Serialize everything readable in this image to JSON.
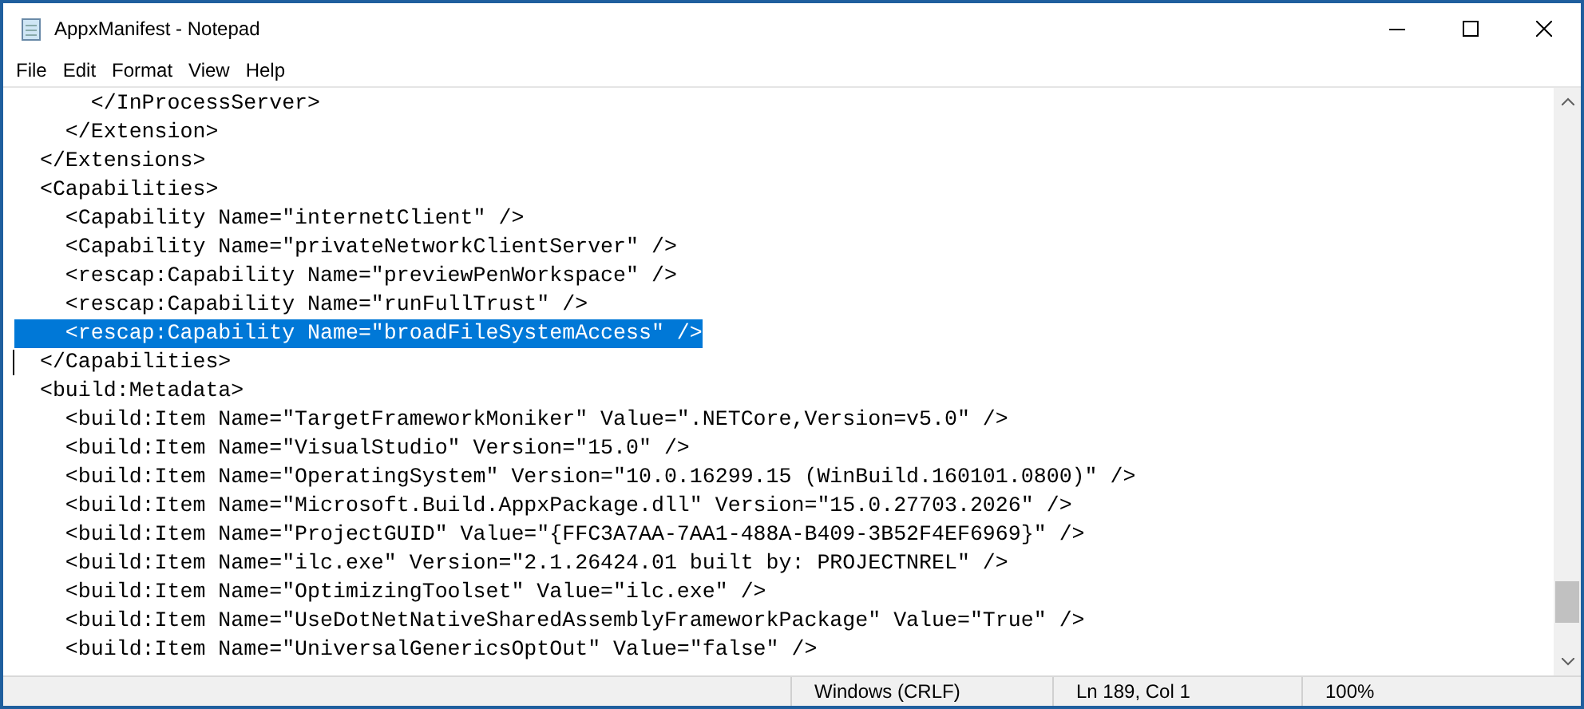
{
  "window": {
    "title": "AppxManifest - Notepad"
  },
  "menu": [
    "File",
    "Edit",
    "Format",
    "View",
    "Help"
  ],
  "editor": {
    "lines": [
      {
        "text": "      </InProcessServer>",
        "selected": false,
        "caret": false
      },
      {
        "text": "    </Extension>",
        "selected": false,
        "caret": false
      },
      {
        "text": "  </Extensions>",
        "selected": false,
        "caret": false
      },
      {
        "text": "  <Capabilities>",
        "selected": false,
        "caret": false
      },
      {
        "text": "    <Capability Name=\"internetClient\" />",
        "selected": false,
        "caret": false
      },
      {
        "text": "    <Capability Name=\"privateNetworkClientServer\" />",
        "selected": false,
        "caret": false
      },
      {
        "text": "    <rescap:Capability Name=\"previewPenWorkspace\" />",
        "selected": false,
        "caret": false
      },
      {
        "text": "    <rescap:Capability Name=\"runFullTrust\" />",
        "selected": false,
        "caret": false
      },
      {
        "text": "    <rescap:Capability Name=\"broadFileSystemAccess\" />",
        "selected": true,
        "caret": false
      },
      {
        "text": "  </Capabilities>",
        "selected": false,
        "caret": true
      },
      {
        "text": "  <build:Metadata>",
        "selected": false,
        "caret": false
      },
      {
        "text": "    <build:Item Name=\"TargetFrameworkMoniker\" Value=\".NETCore,Version=v5.0\" />",
        "selected": false,
        "caret": false
      },
      {
        "text": "    <build:Item Name=\"VisualStudio\" Version=\"15.0\" />",
        "selected": false,
        "caret": false
      },
      {
        "text": "    <build:Item Name=\"OperatingSystem\" Version=\"10.0.16299.15 (WinBuild.160101.0800)\" />",
        "selected": false,
        "caret": false
      },
      {
        "text": "    <build:Item Name=\"Microsoft.Build.AppxPackage.dll\" Version=\"15.0.27703.2026\" />",
        "selected": false,
        "caret": false
      },
      {
        "text": "    <build:Item Name=\"ProjectGUID\" Value=\"{FFC3A7AA-7AA1-488A-B409-3B52F4EF6969}\" />",
        "selected": false,
        "caret": false
      },
      {
        "text": "    <build:Item Name=\"ilc.exe\" Version=\"2.1.26424.01 built by: PROJECTNREL\" />",
        "selected": false,
        "caret": false
      },
      {
        "text": "    <build:Item Name=\"OptimizingToolset\" Value=\"ilc.exe\" />",
        "selected": false,
        "caret": false
      },
      {
        "text": "    <build:Item Name=\"UseDotNetNativeSharedAssemblyFrameworkPackage\" Value=\"True\" />",
        "selected": false,
        "caret": false
      },
      {
        "text": "    <build:Item Name=\"UniversalGenericsOptOut\" Value=\"false\" />",
        "selected": false,
        "caret": false
      }
    ]
  },
  "status_bar": [
    "Windows (CRLF)",
    "Ln 189, Col 1",
    "100%"
  ]
}
